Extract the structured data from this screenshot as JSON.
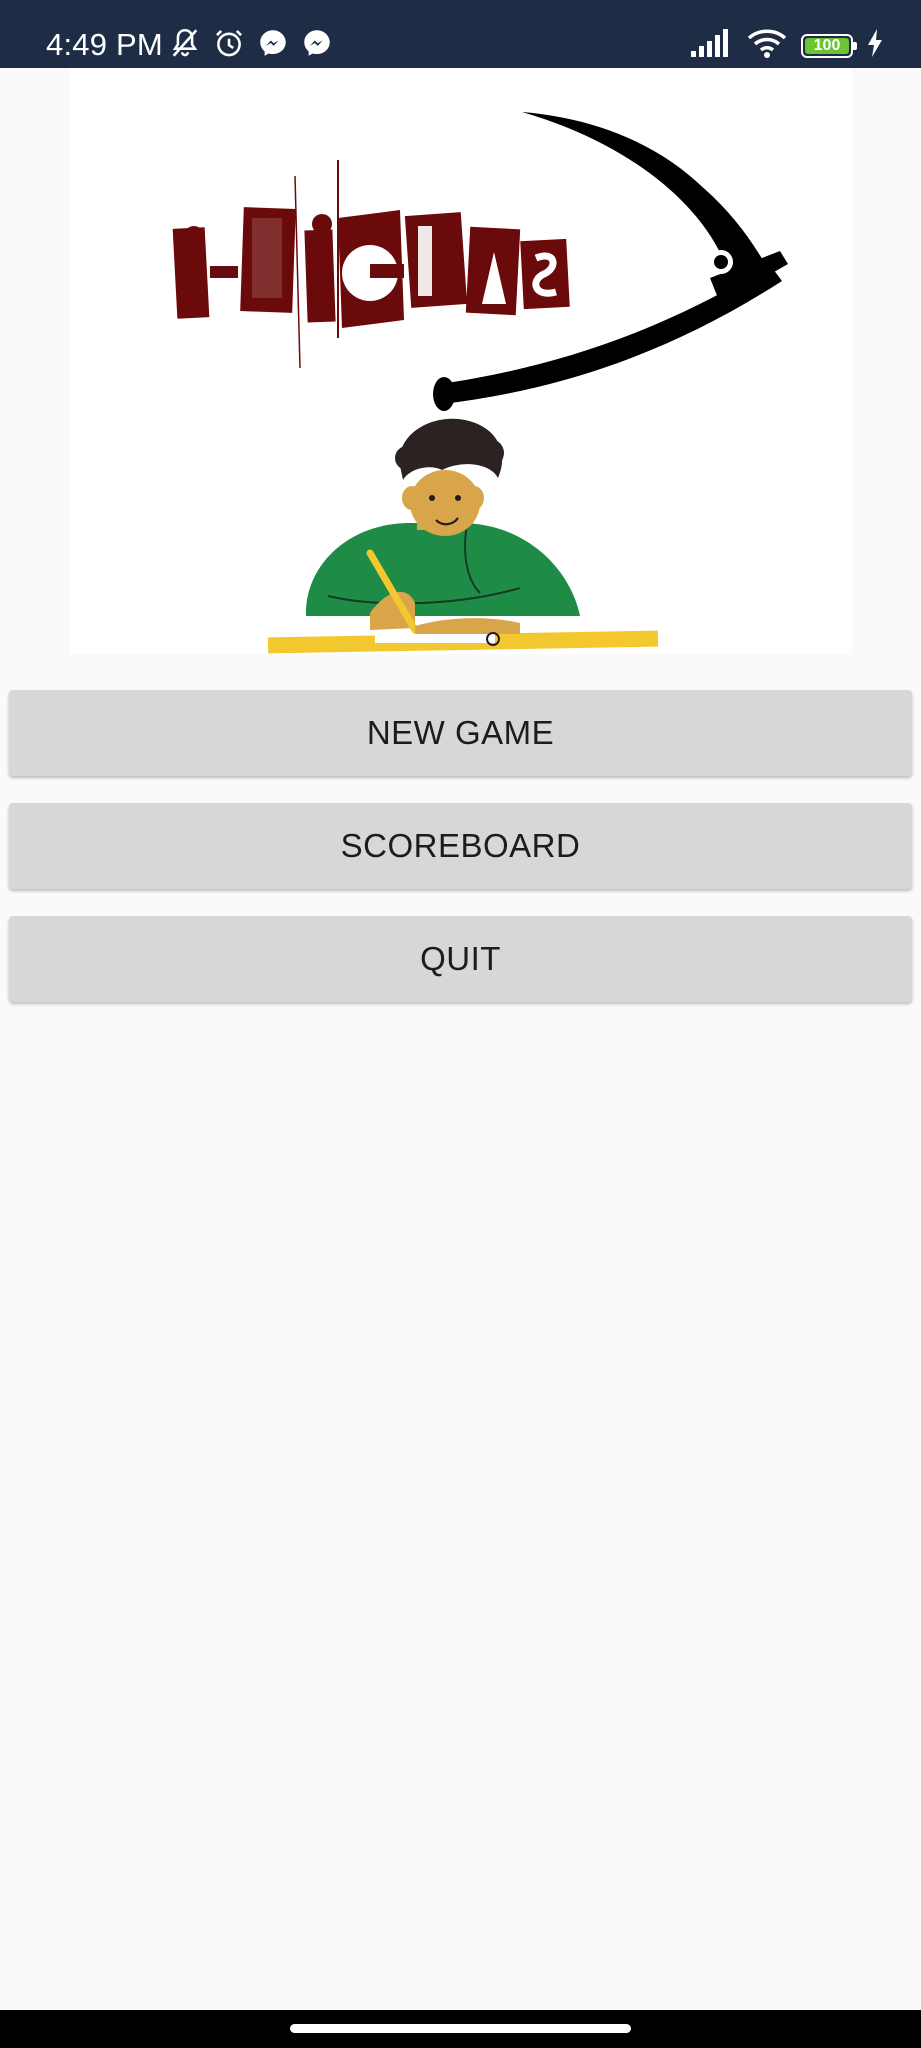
{
  "status_bar": {
    "time": "4:49 PM",
    "left_icons": [
      "bell-off-icon",
      "alarm-icon",
      "messenger-icon",
      "messenger-icon"
    ],
    "right_icons": [
      "signal-icon",
      "wifi-icon",
      "battery-icon",
      "charging-icon"
    ],
    "battery_level": "100",
    "battery_color": "#6dc430",
    "background": "#1e2d45"
  },
  "hero": {
    "logo_text": "i-LiGTAS",
    "logo_color": "#6b0a0a",
    "illustration": "boy-writing-illustration"
  },
  "menu": {
    "new_game_label": "NEW GAME",
    "scoreboard_label": "SCOREBOARD",
    "quit_label": "QUIT"
  }
}
